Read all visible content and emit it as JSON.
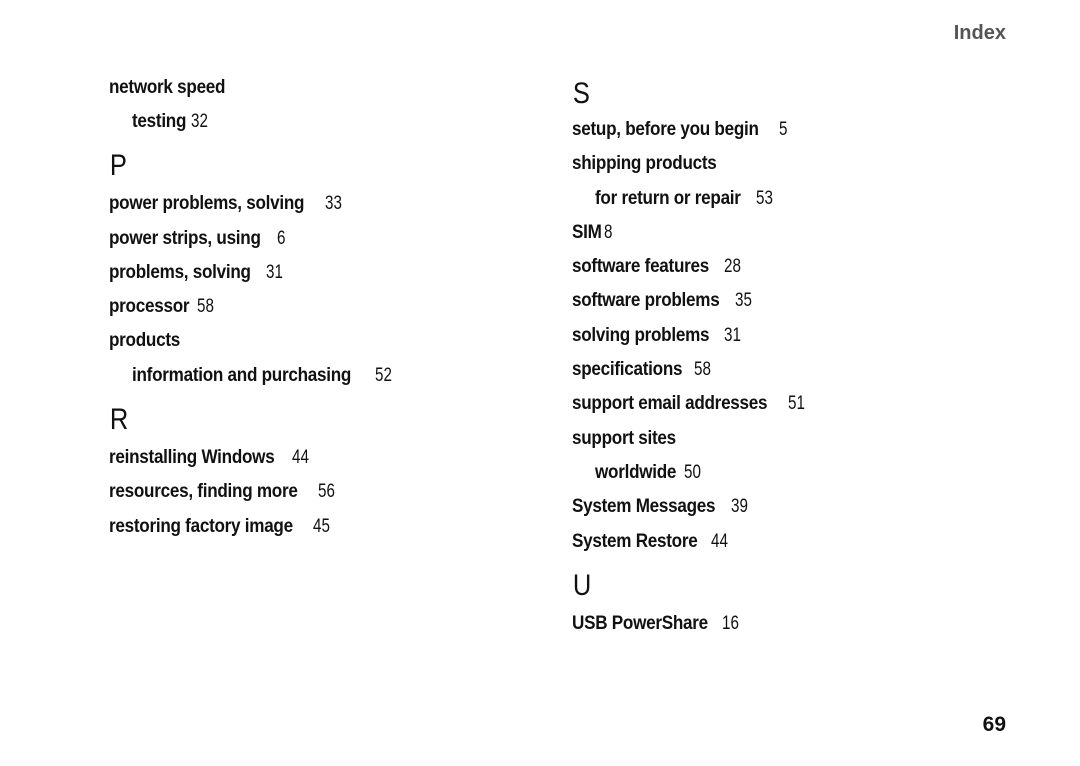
{
  "header": {
    "title": "Index"
  },
  "page_number": "69",
  "left_column": {
    "continued": [
      {
        "term": "network speed",
        "page": ""
      },
      {
        "term": "testing",
        "page": "32",
        "sub": true
      }
    ],
    "sections": [
      {
        "letter": "P",
        "entries": [
          {
            "term": "power problems, solving",
            "page": "33"
          },
          {
            "term": "power strips, using",
            "page": "6"
          },
          {
            "term": "problems, solving",
            "page": "31"
          },
          {
            "term": "processor",
            "page": "58"
          },
          {
            "term": "products",
            "page": ""
          },
          {
            "term": "information and purchasing",
            "page": "52",
            "sub": true
          }
        ]
      },
      {
        "letter": "R",
        "entries": [
          {
            "term": "reinstalling Windows",
            "page": "44"
          },
          {
            "term": "resources, finding more",
            "page": "56"
          },
          {
            "term": "restoring factory image",
            "page": "45"
          }
        ]
      }
    ]
  },
  "right_column": {
    "sections": [
      {
        "letter": "S",
        "entries": [
          {
            "term": "setup, before you begin",
            "page": "5"
          },
          {
            "term": "shipping products",
            "page": ""
          },
          {
            "term": "for return or repair",
            "page": "53",
            "sub": true
          },
          {
            "term": "SIM",
            "page": "8"
          },
          {
            "term": "software features",
            "page": "28"
          },
          {
            "term": "software problems",
            "page": "35"
          },
          {
            "term": "solving problems",
            "page": "31"
          },
          {
            "term": "specifications",
            "page": "58"
          },
          {
            "term": "support email addresses",
            "page": "51"
          },
          {
            "term": "support sites",
            "page": ""
          },
          {
            "term": "worldwide",
            "page": "50",
            "sub": true
          },
          {
            "term": "System Messages",
            "page": "39"
          },
          {
            "term": "System Restore",
            "page": "44"
          }
        ]
      },
      {
        "letter": "U",
        "entries": [
          {
            "term": "USB PowerShare",
            "page": "16"
          }
        ]
      }
    ]
  }
}
